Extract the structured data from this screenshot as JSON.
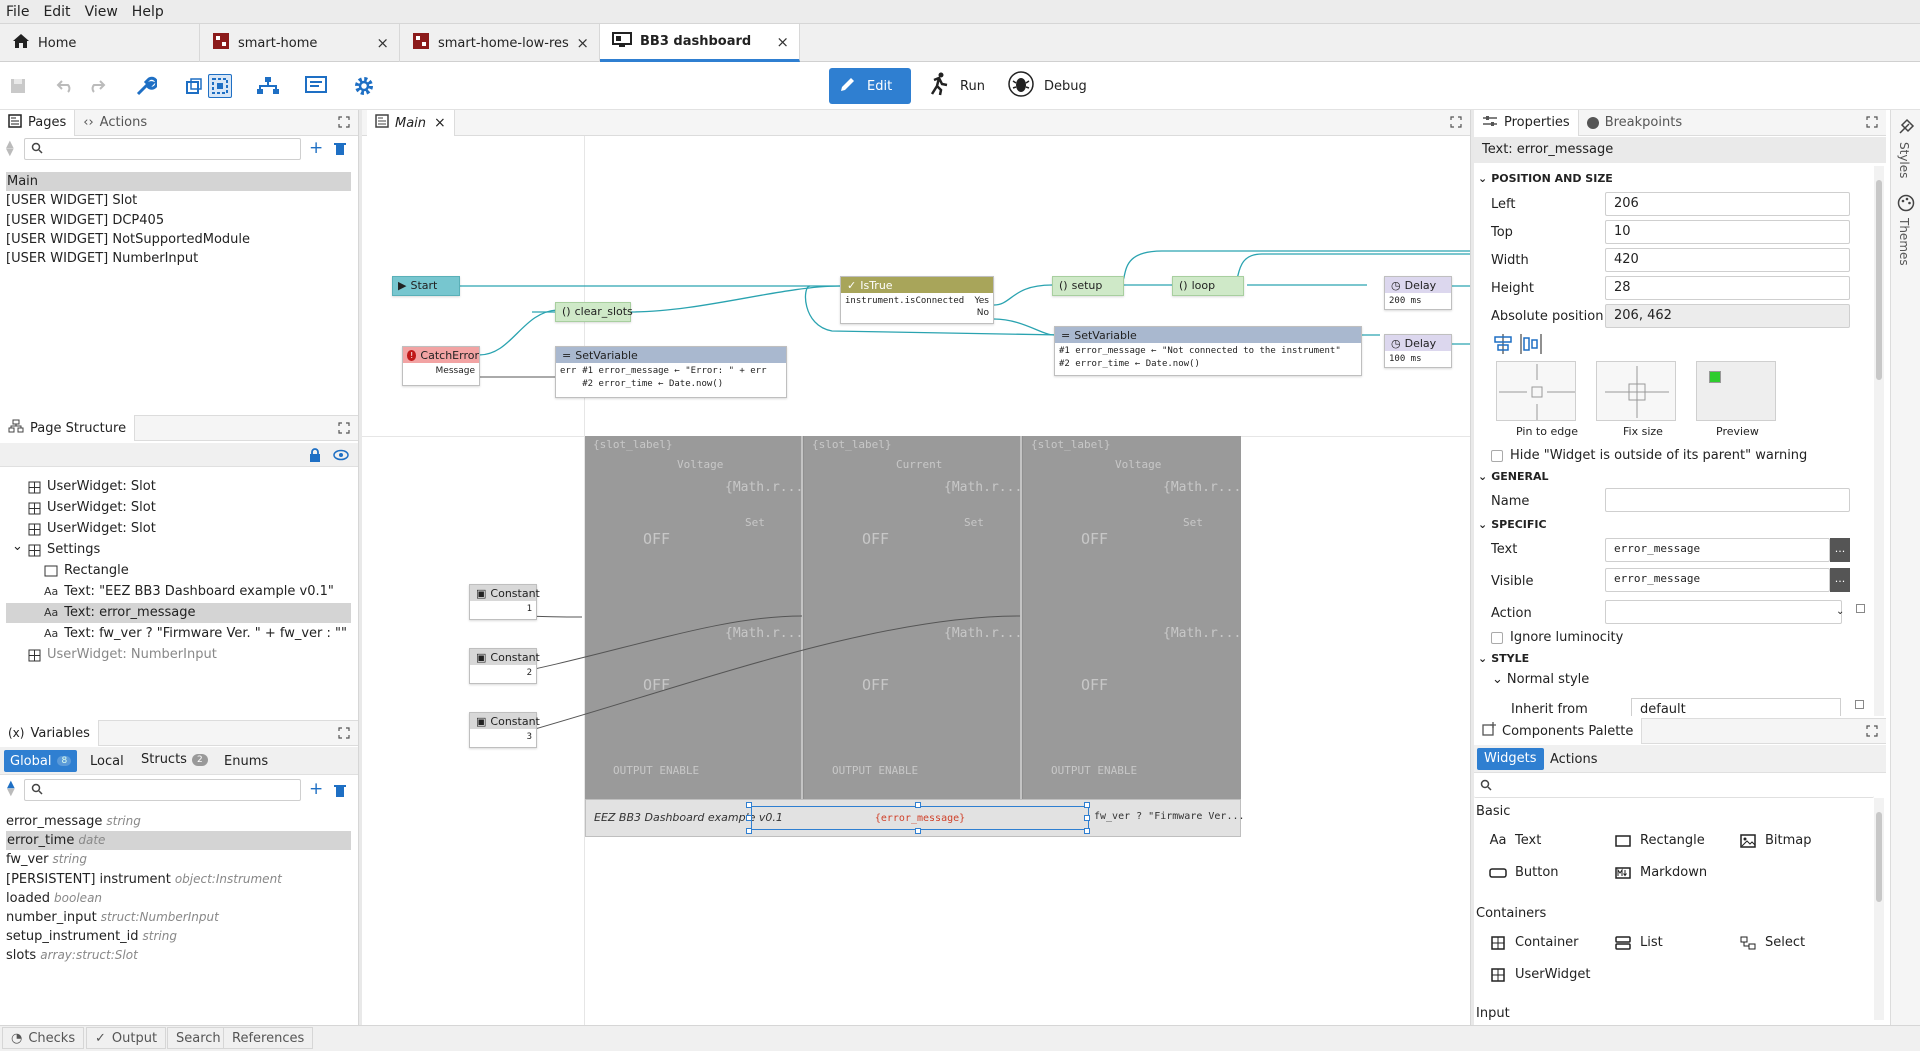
{
  "menu": {
    "file": "File",
    "edit": "Edit",
    "view": "View",
    "help": "Help"
  },
  "tabs": [
    {
      "label": "Home"
    },
    {
      "label": "smart-home",
      "close": "×"
    },
    {
      "label": "smart-home-low-res",
      "close": "×"
    },
    {
      "label": "BB3 dashboard",
      "close": "×"
    }
  ],
  "modes": {
    "edit": "Edit",
    "run": "Run",
    "debug": "Debug"
  },
  "pages_panel": {
    "tab_pages": "Pages",
    "tab_actions": "Actions",
    "items": [
      "Main",
      "[USER WIDGET] Slot",
      "[USER WIDGET] DCP405",
      "[USER WIDGET] NotSupportedModule",
      "[USER WIDGET] NumberInput"
    ]
  },
  "structure_panel": {
    "title": "Page Structure",
    "items": [
      "UserWidget: Slot",
      "UserWidget: Slot",
      "UserWidget: Slot",
      "Settings",
      "Rectangle",
      "Text: \"EEZ BB3 Dashboard example v0.1\"",
      "Text: error_message",
      "Text: fw_ver ? \"Firmware Ver. \" + fw_ver : \"\"",
      "UserWidget: NumberInput"
    ]
  },
  "variables_panel": {
    "title": "Variables",
    "tabs": [
      {
        "label": "Global",
        "count": "8"
      },
      {
        "label": "Local"
      },
      {
        "label": "Structs",
        "count": "2"
      },
      {
        "label": "Enums"
      }
    ],
    "items": [
      {
        "name": "error_message",
        "type": "string"
      },
      {
        "name": "error_time",
        "type": "date"
      },
      {
        "name": "fw_ver",
        "type": "string"
      },
      {
        "name": "[PERSISTENT] instrument",
        "type": "object:Instrument"
      },
      {
        "name": "loaded",
        "type": "boolean"
      },
      {
        "name": "number_input",
        "type": "struct:NumberInput"
      },
      {
        "name": "setup_instrument_id",
        "type": "string"
      },
      {
        "name": "slots",
        "type": "array:struct:Slot"
      }
    ]
  },
  "editor": {
    "tab_label": "Main",
    "tab_close": "×",
    "nodes": {
      "start": "Start",
      "clear_slots": "clear_slots",
      "istrue": "IsTrue",
      "istrue_expr": "instrument.isConnected",
      "istrue_yes": "Yes",
      "istrue_no": "No",
      "setup": "setup",
      "loop": "loop",
      "delay1": "Delay",
      "delay1_val": "200 ms",
      "delay2": "Delay",
      "delay2_val": "100 ms",
      "catcherror": "CatchError",
      "catcherror_msg": "Message",
      "setvar1": "SetVariable",
      "setvar1_in": "err",
      "setvar1_line1": "#1 error_message  ←  \"Error: \" + err",
      "setvar1_line2": "#2 error_time  ←  Date.now()",
      "setvar2": "SetVariable",
      "setvar2_line1": "#1 error_message  ←  \"Not connected to the instrument\"",
      "setvar2_line2": "#2 error_time  ←  Date.now()",
      "const1": "Constant",
      "const1_val": "1",
      "const2": "Constant",
      "const2_val": "2",
      "const3": "Constant",
      "const3_val": "3"
    },
    "widget_texts": {
      "slot_label": "{slot_label}",
      "voltage": "Voltage",
      "current": "Current",
      "math1": "{Math.r...",
      "math2": "{Math.r...",
      "set": "Set",
      "off": "OFF",
      "output_enable": "OUTPUT ENABLE",
      "footer_title": "EEZ BB3 Dashboard example v0.1",
      "footer_error": "{error_message}",
      "footer_fw": "fw_ver ? \"Firmware Ver..."
    }
  },
  "properties": {
    "tab_properties": "Properties",
    "tab_breakpoints": "Breakpoints",
    "subject": "Text: error_message",
    "section_position": "POSITION AND SIZE",
    "left_label": "Left",
    "left": "206",
    "top_label": "Top",
    "top": "10",
    "width_label": "Width",
    "width": "420",
    "height_label": "Height",
    "height": "28",
    "abs_label": "Absolute position",
    "abs": "206, 462",
    "pin_label": "Pin to edge",
    "fix_label": "Fix size",
    "preview_label": "Preview",
    "hide_warning": "Hide \"Widget is outside of its parent\" warning",
    "section_general": "GENERAL",
    "name_label": "Name",
    "name": "",
    "section_specific": "SPECIFIC",
    "text_label": "Text",
    "text": "error_message",
    "visible_label": "Visible",
    "visible": "error_message",
    "action_label": "Action",
    "action": "",
    "ignore_lum": "Ignore luminocity",
    "section_style": "STYLE",
    "normal_style": "Normal style",
    "inherit_label": "Inherit from",
    "inherit": "default",
    "more_btn": "..."
  },
  "side_strip": {
    "styles": "Styles",
    "themes": "Themes"
  },
  "palette": {
    "title": "Components Palette",
    "tab_widgets": "Widgets",
    "tab_actions": "Actions",
    "basic_label": "Basic",
    "basic": [
      "Text",
      "Rectangle",
      "Bitmap",
      "Button",
      "Markdown"
    ],
    "containers_label": "Containers",
    "containers": [
      "Container",
      "List",
      "Select",
      "UserWidget"
    ],
    "input_label": "Input"
  },
  "bottom_tabs": [
    "Checks",
    "Output",
    "Search",
    "References"
  ],
  "colors": {
    "accent": "#2f7fd1",
    "flow_line": "#2aa3b0",
    "istrue": "#a8a55a",
    "start": "#77c6cf",
    "catch": "#f2a3a3",
    "setvar": "#a9b8cf"
  }
}
